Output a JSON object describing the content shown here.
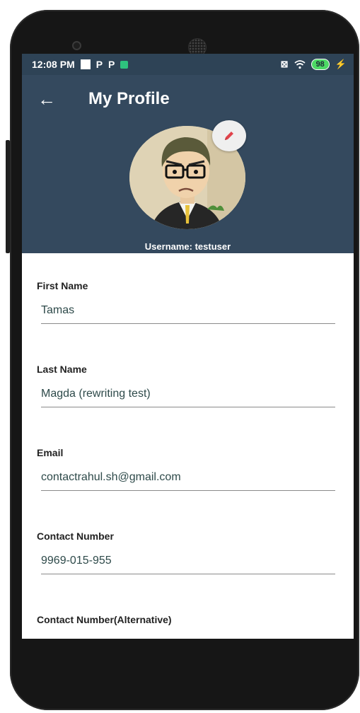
{
  "status": {
    "time": "12:08 PM",
    "icons": [
      "p-icon",
      "p-icon",
      "app-icon"
    ],
    "p_label": "P",
    "battery": "98",
    "charging": "⚡"
  },
  "appbar": {
    "back_icon": "←",
    "title": "My Profile"
  },
  "profile": {
    "username": "Username: testuser"
  },
  "fields": [
    {
      "label": "First Name",
      "value": "Tamas"
    },
    {
      "label": "Last Name",
      "value": "Magda (rewriting test)"
    },
    {
      "label": "Email",
      "value": "contactrahul.sh@gmail.com"
    },
    {
      "label": "Contact Number",
      "value": "9969-015-955"
    },
    {
      "label": "Contact Number(Alternative)"
    }
  ],
  "colors": {
    "header": "#34495e",
    "statusbar": "#2e4356",
    "edit_icon": "#e0434b"
  }
}
